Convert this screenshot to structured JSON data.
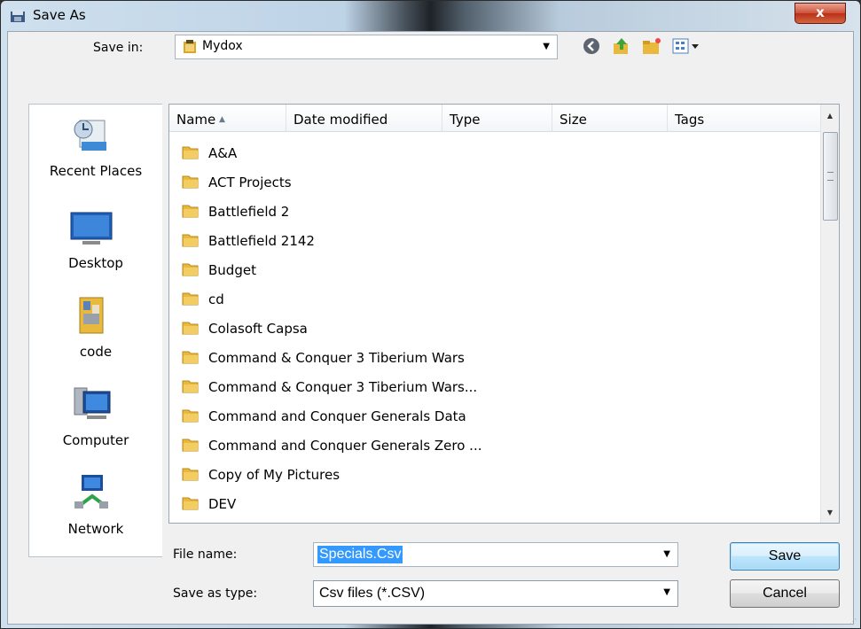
{
  "window": {
    "title": "Save As",
    "close_glyph": "x"
  },
  "toolbar": {
    "save_in_label": "Save in:",
    "location": "Mydox",
    "icons": [
      "back-icon",
      "up-folder-icon",
      "new-folder-icon",
      "views-icon"
    ]
  },
  "places": [
    {
      "label": "Recent Places",
      "icon": "recent-places-icon"
    },
    {
      "label": "Desktop",
      "icon": "desktop-icon"
    },
    {
      "label": "code",
      "icon": "code-folder-icon"
    },
    {
      "label": "Computer",
      "icon": "computer-icon"
    },
    {
      "label": "Network",
      "icon": "network-icon"
    }
  ],
  "list": {
    "columns": [
      "Name",
      "Date modified",
      "Type",
      "Size",
      "Tags"
    ],
    "items": [
      "A&A",
      "ACT Projects",
      "Battlefield 2",
      "Battlefield 2142",
      "Budget",
      "cd",
      "Colasoft Capsa",
      "Command & Conquer 3 Tiberium Wars",
      "Command & Conquer 3 Tiberium Wars...",
      "Command and Conquer Generals Data",
      "Command and Conquer Generals Zero ...",
      "Copy of My Pictures",
      "DEV"
    ]
  },
  "form": {
    "file_name_label": "File name:",
    "file_name_value": "Specials.Csv",
    "save_type_label": "Save as type:",
    "save_type_value": "Csv files (*.CSV)"
  },
  "buttons": {
    "save": "Save",
    "cancel": "Cancel"
  },
  "colors": {
    "folder": "#e8b93c",
    "selection": "#3399ff",
    "default_button": "#bee6fd"
  }
}
